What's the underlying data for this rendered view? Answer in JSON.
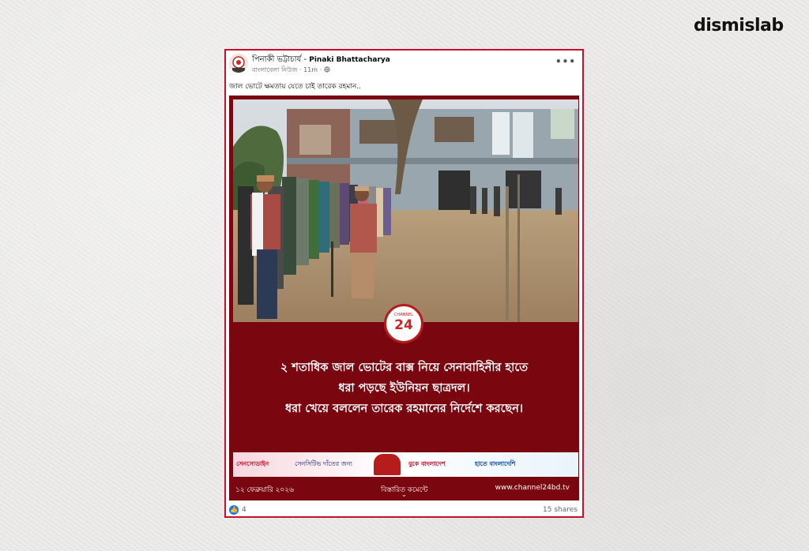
{
  "brand": {
    "name": "dismislab"
  },
  "post": {
    "author_bn": "পিনাকী ভট্টাচার্য",
    "author_separator": " - ",
    "author_en": "Pinaki Bhattacharya",
    "source": "বাংলাবেলা নিউজ",
    "time": "11m",
    "more_label": "•••",
    "caption": "জাল ভোটে ক্ষমতায় যেতে চাই তারেক রহমান..",
    "card": {
      "logo_small": "CHANNEL",
      "logo_number": "24",
      "headline_lines": [
        "২ শতাধিক জাল ভোটের বাক্স নিয়ে সেনাবাহিনীর হাতে",
        "ধরা পড়ছে ইউনিয়ন ছাত্রদল।",
        "ধরা খেয়ে বললেন তারেক রহমানের নির্দেশে করছেন।"
      ],
      "ad": {
        "a": "সেনসোডাইন",
        "b": "সেনসিটিভ দাঁতের জন্য",
        "c": "বুকে বাংলাদেশ",
        "d": "হাতে বাংলাদেশি"
      },
      "date": "১২ ফেব্রুয়ারি ২০২৬",
      "details": "বিস্তারিত কমেন্টে",
      "url": "www.channel24bd.tv"
    },
    "reactions_count": "4",
    "shares": "15 shares"
  },
  "icons": {
    "like": "like-icon",
    "more": "more-dots-icon",
    "globe": "globe-icon",
    "chevron": "chevron-down-icon"
  },
  "colors": {
    "border_accent": "#c8102e",
    "card_bg": "#7a0710",
    "facebook_blue": "#1877f2"
  }
}
